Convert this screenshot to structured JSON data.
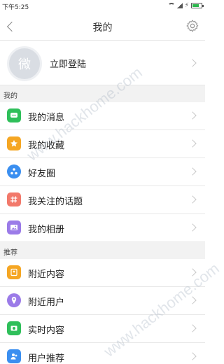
{
  "statusbar": {
    "time": "下午5:25"
  },
  "navbar": {
    "title": "我的"
  },
  "profile": {
    "avatar_char": "微",
    "login_label": "立即登陆"
  },
  "sections": {
    "mine": "我的",
    "recommend": "推荐"
  },
  "mine_items": [
    {
      "label": "我的消息",
      "icon": "message-icon",
      "color": "#2fbf5a"
    },
    {
      "label": "我的收藏",
      "icon": "star-icon",
      "color": "#f5a623"
    },
    {
      "label": "好友圈",
      "icon": "friends-circle-icon",
      "color": "#3b8ff0"
    },
    {
      "label": "我关注的话题",
      "icon": "hashtag-icon",
      "color": "#f2796b"
    },
    {
      "label": "我的相册",
      "icon": "photo-album-icon",
      "color": "#9b7be8"
    }
  ],
  "recommend_items": [
    {
      "label": "附近内容",
      "icon": "nearby-content-icon",
      "color": "#f5a623"
    },
    {
      "label": "附近用户",
      "icon": "location-pin-icon",
      "color": "#9b7be8"
    },
    {
      "label": "实时内容",
      "icon": "realtime-content-icon",
      "color": "#2fbf5a"
    },
    {
      "label": "用户推荐",
      "icon": "user-recommend-icon",
      "color": "#3b8ff0"
    }
  ],
  "watermark": "www.hackhome.com"
}
